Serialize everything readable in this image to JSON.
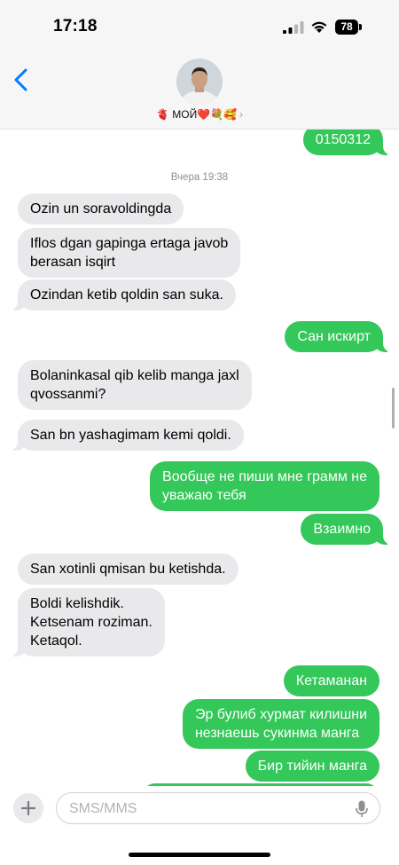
{
  "status_bar": {
    "time": "17:18",
    "battery_level": "78"
  },
  "header": {
    "contact_name": "🫀 МОЙ❤️💐🥰",
    "chevron": "›"
  },
  "timestamps": [
    "Вчера 19:38"
  ],
  "messages": [
    {
      "direction": "outgoing",
      "text": "0150312"
    },
    {
      "direction": "incoming",
      "text": "Ozin un soravoldingda"
    },
    {
      "direction": "incoming",
      "text": "Iflos dgan gapinga ertaga javob\nberasan isqirt"
    },
    {
      "direction": "incoming",
      "text": "Ozindan ketib qoldin san suka."
    },
    {
      "direction": "outgoing",
      "text": "Сан искирт"
    },
    {
      "direction": "incoming",
      "text": "Bolaninkasal qib kelib manga jaxl\nqvossanmi?"
    },
    {
      "direction": "incoming",
      "text": "San bn yashagimam kemi qoldi."
    },
    {
      "direction": "outgoing",
      "text": "Вообще не пиши мне грамм не\nуважаю тебя"
    },
    {
      "direction": "outgoing",
      "text": "Взаимно"
    },
    {
      "direction": "incoming",
      "text": "San xotinli qmisan bu ketishda."
    },
    {
      "direction": "incoming",
      "text": "Boldi kelishdik.\nKetsenam roziman.\nKetaqol."
    },
    {
      "direction": "outgoing",
      "text": "Кетаманан"
    },
    {
      "direction": "outgoing",
      "text": "Эр булиб хурмат килишни\nнезнаешь сукинма манга"
    },
    {
      "direction": "outgoing",
      "text": "Бир тийин манга"
    }
  ],
  "composer": {
    "placeholder": "SMS/MMS"
  },
  "colors": {
    "outgoing_bubble": "#34c759",
    "incoming_bubble": "#e9e9eb",
    "accent": "#007aff"
  }
}
